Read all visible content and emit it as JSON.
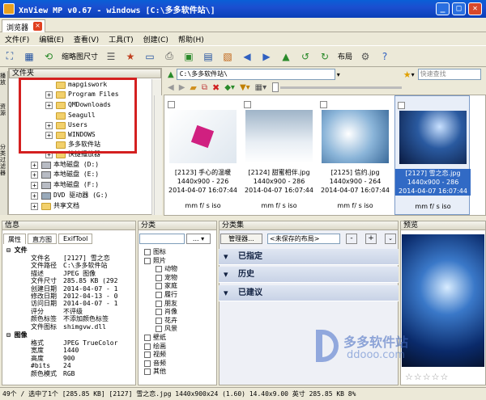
{
  "window": {
    "title": "XnView MP v0.67 - windows [C:\\多多软件站\\]"
  },
  "tab": {
    "label": "浏览器"
  },
  "menu": [
    "文件(F)",
    "编辑(E)",
    "查看(V)",
    "工具(T)",
    "创建(C)",
    "帮助(H)"
  ],
  "toolbar": {
    "thumb_size": "缩略图尺寸",
    "layout": "布局"
  },
  "folders": {
    "title": "文件夹",
    "items": [
      "mapgiswork",
      "Program Files",
      "QMDownloads",
      "Seagull",
      "Users",
      "WINDOWS",
      "多多软件站",
      "快捷播放器",
      "本地磁盘 (D:)",
      "本地磁盘 (E:)",
      "本地磁盘 (F:)",
      "DVD 驱动器 (G:)",
      "共享文档"
    ]
  },
  "side_tabs": [
    "播放",
    "资源",
    "分类过滤器"
  ],
  "browser": {
    "path": "C:\\多多软件站\\",
    "search_placeholder": "快速查找"
  },
  "thumbs": [
    {
      "name": "[2123] 手心的温暖",
      "size": "1440x900 - 226",
      "date": "2014-04-07 16:07:44",
      "meta": "mm f/ s iso"
    },
    {
      "name": "[2124] 甜蜜相伴.jpg",
      "size": "1440x900 - 286",
      "date": "2014-04-07 16:07:44",
      "meta": "mm f/ s iso"
    },
    {
      "name": "[2125] 信约.jpg",
      "size": "1440x900 - 264",
      "date": "2014-04-07 16:07:44",
      "meta": "mm f/ s iso"
    },
    {
      "name": "[2127] 雪之恋.jpg",
      "size": "1440x900 - 286",
      "date": "2014-04-07 16:07:44",
      "meta": "mm f/ s iso"
    }
  ],
  "info": {
    "title": "信息",
    "tabs": [
      "属性",
      "直方图",
      "ExifTool"
    ],
    "file_hdr": "文件",
    "file_rows": [
      [
        "文件名",
        "[2127] 雪之恋"
      ],
      [
        "文件路径",
        "C:\\多多软件站"
      ],
      [
        "描述",
        "JPEG 图像"
      ],
      [
        "文件尺寸",
        "285.85 KB (292"
      ],
      [
        "创建日期",
        "2014-04-07 - 1"
      ],
      [
        "修改日期",
        "2012-04-13 - 0"
      ],
      [
        "访问日期",
        "2014-04-07 - 1"
      ],
      [
        "评分",
        "不评级"
      ],
      [
        "颜色标签",
        "不添加颜色标签"
      ],
      [
        "文件图标",
        "shimgvw.dll"
      ]
    ],
    "image_hdr": "图像",
    "image_rows": [
      [
        "格式",
        "JPEG TrueColor"
      ],
      [
        "宽度",
        "1440"
      ],
      [
        "高度",
        "900"
      ],
      [
        "#bits",
        "24"
      ],
      [
        "颜色模式",
        "RGB"
      ]
    ]
  },
  "categories": {
    "title": "分类",
    "items": [
      "图标",
      "照片",
      "动物",
      "宠物",
      "家庭",
      "履行",
      "朋友",
      "肖像",
      "花卉",
      "风景",
      "壁纸",
      "绘画",
      "视频",
      "音频",
      "其他"
    ]
  },
  "catsets": {
    "title": "分类集",
    "manager": "管理器...",
    "layout": "<未保存的布局>",
    "sections": [
      "已指定",
      "历史",
      "已建议"
    ]
  },
  "preview": {
    "title": "预览",
    "watermark_cn": "多多软件站",
    "watermark_en": "ddooo.com"
  },
  "status": "49个 / 选中了1个 [285.85 KB]  [2127] 雪之恋.jpg 1440x900x24 (1.60) 14.40x9.00 英寸 285.85 KB 8%"
}
